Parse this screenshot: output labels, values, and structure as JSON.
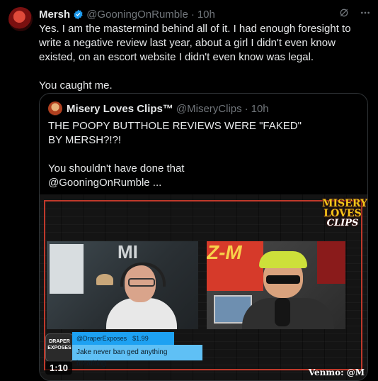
{
  "tweet": {
    "author_name": "Mersh",
    "handle": "@GooningOnRumble",
    "separator": "·",
    "time": "10h",
    "text": "Yes. I am the mastermind behind all of it. I had enough foresight to write a negative review last year, about a girl I didn't even know existed, on an escort website I didn't even know was legal.\n\nYou caught me."
  },
  "quote": {
    "author_name": "Misery Loves Clips™",
    "handle": "@MiseryClips",
    "separator": "·",
    "time": "10h",
    "text": "THE POOPY BUTTHOLE REVIEWS WERE \"FAKED\"\nBY MERSH?!?!\n\nYou shouldn't have done that\n@GooningOnRumble ..."
  },
  "video": {
    "logo_line1": "MISERY",
    "logo_line2": "LOVES",
    "logo_line3": "CLIPS",
    "chat_user": "@DraperExposes",
    "chat_amount": "$1.99",
    "chat_message": "Jake never ban ged anything breathing",
    "badge_text": "DRAPER EXPOSES",
    "duration": "1:10",
    "watermark": "Venmo: @M",
    "sign_text": "MI",
    "z_text": "Z-M"
  },
  "icons": {
    "verified": "verified-badge-icon",
    "grok": "grok-icon",
    "more": "more-options-icon"
  },
  "colors": {
    "background": "#000000",
    "text": "#e7e9ea",
    "muted": "#71767b",
    "verified": "#1d9bf0",
    "border": "#2f3336"
  }
}
